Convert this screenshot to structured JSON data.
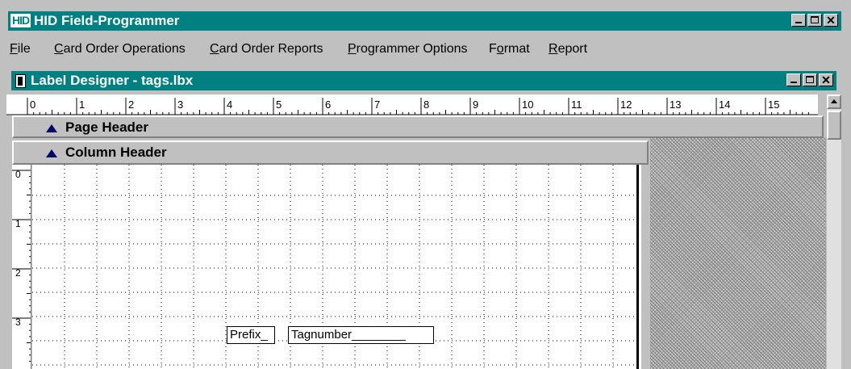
{
  "app": {
    "logo": "HID",
    "title": "HID Field-Programmer"
  },
  "menu": {
    "items": [
      {
        "pre": "",
        "ul": "F",
        "post": "ile"
      },
      {
        "pre": "",
        "ul": "C",
        "post": "ard Order Operations"
      },
      {
        "pre": "",
        "ul": "C",
        "post": "ard Order Reports"
      },
      {
        "pre": "",
        "ul": "P",
        "post": "rogrammer Options"
      },
      {
        "pre": "F",
        "ul": "o",
        "post": "rmat"
      },
      {
        "pre": "",
        "ul": "R",
        "post": "eport"
      }
    ]
  },
  "designer": {
    "title": "Label Designer - tags.lbx",
    "ruler_labels": [
      "0",
      "1",
      "2",
      "3",
      "4",
      "5",
      "6",
      "7",
      "8",
      "9",
      "10",
      "11",
      "12",
      "13",
      "14",
      "15"
    ],
    "vruler_labels": [
      "0",
      "1",
      "2",
      "3"
    ],
    "page_header": "Page Header",
    "column_header": "Column Header",
    "fields": {
      "prefix": "Prefix_",
      "tagnumber": "Tagnumber________"
    }
  },
  "colors": {
    "titlebar": "#008080",
    "face": "#c0c0c0",
    "accent_triangle": "#00006b"
  }
}
